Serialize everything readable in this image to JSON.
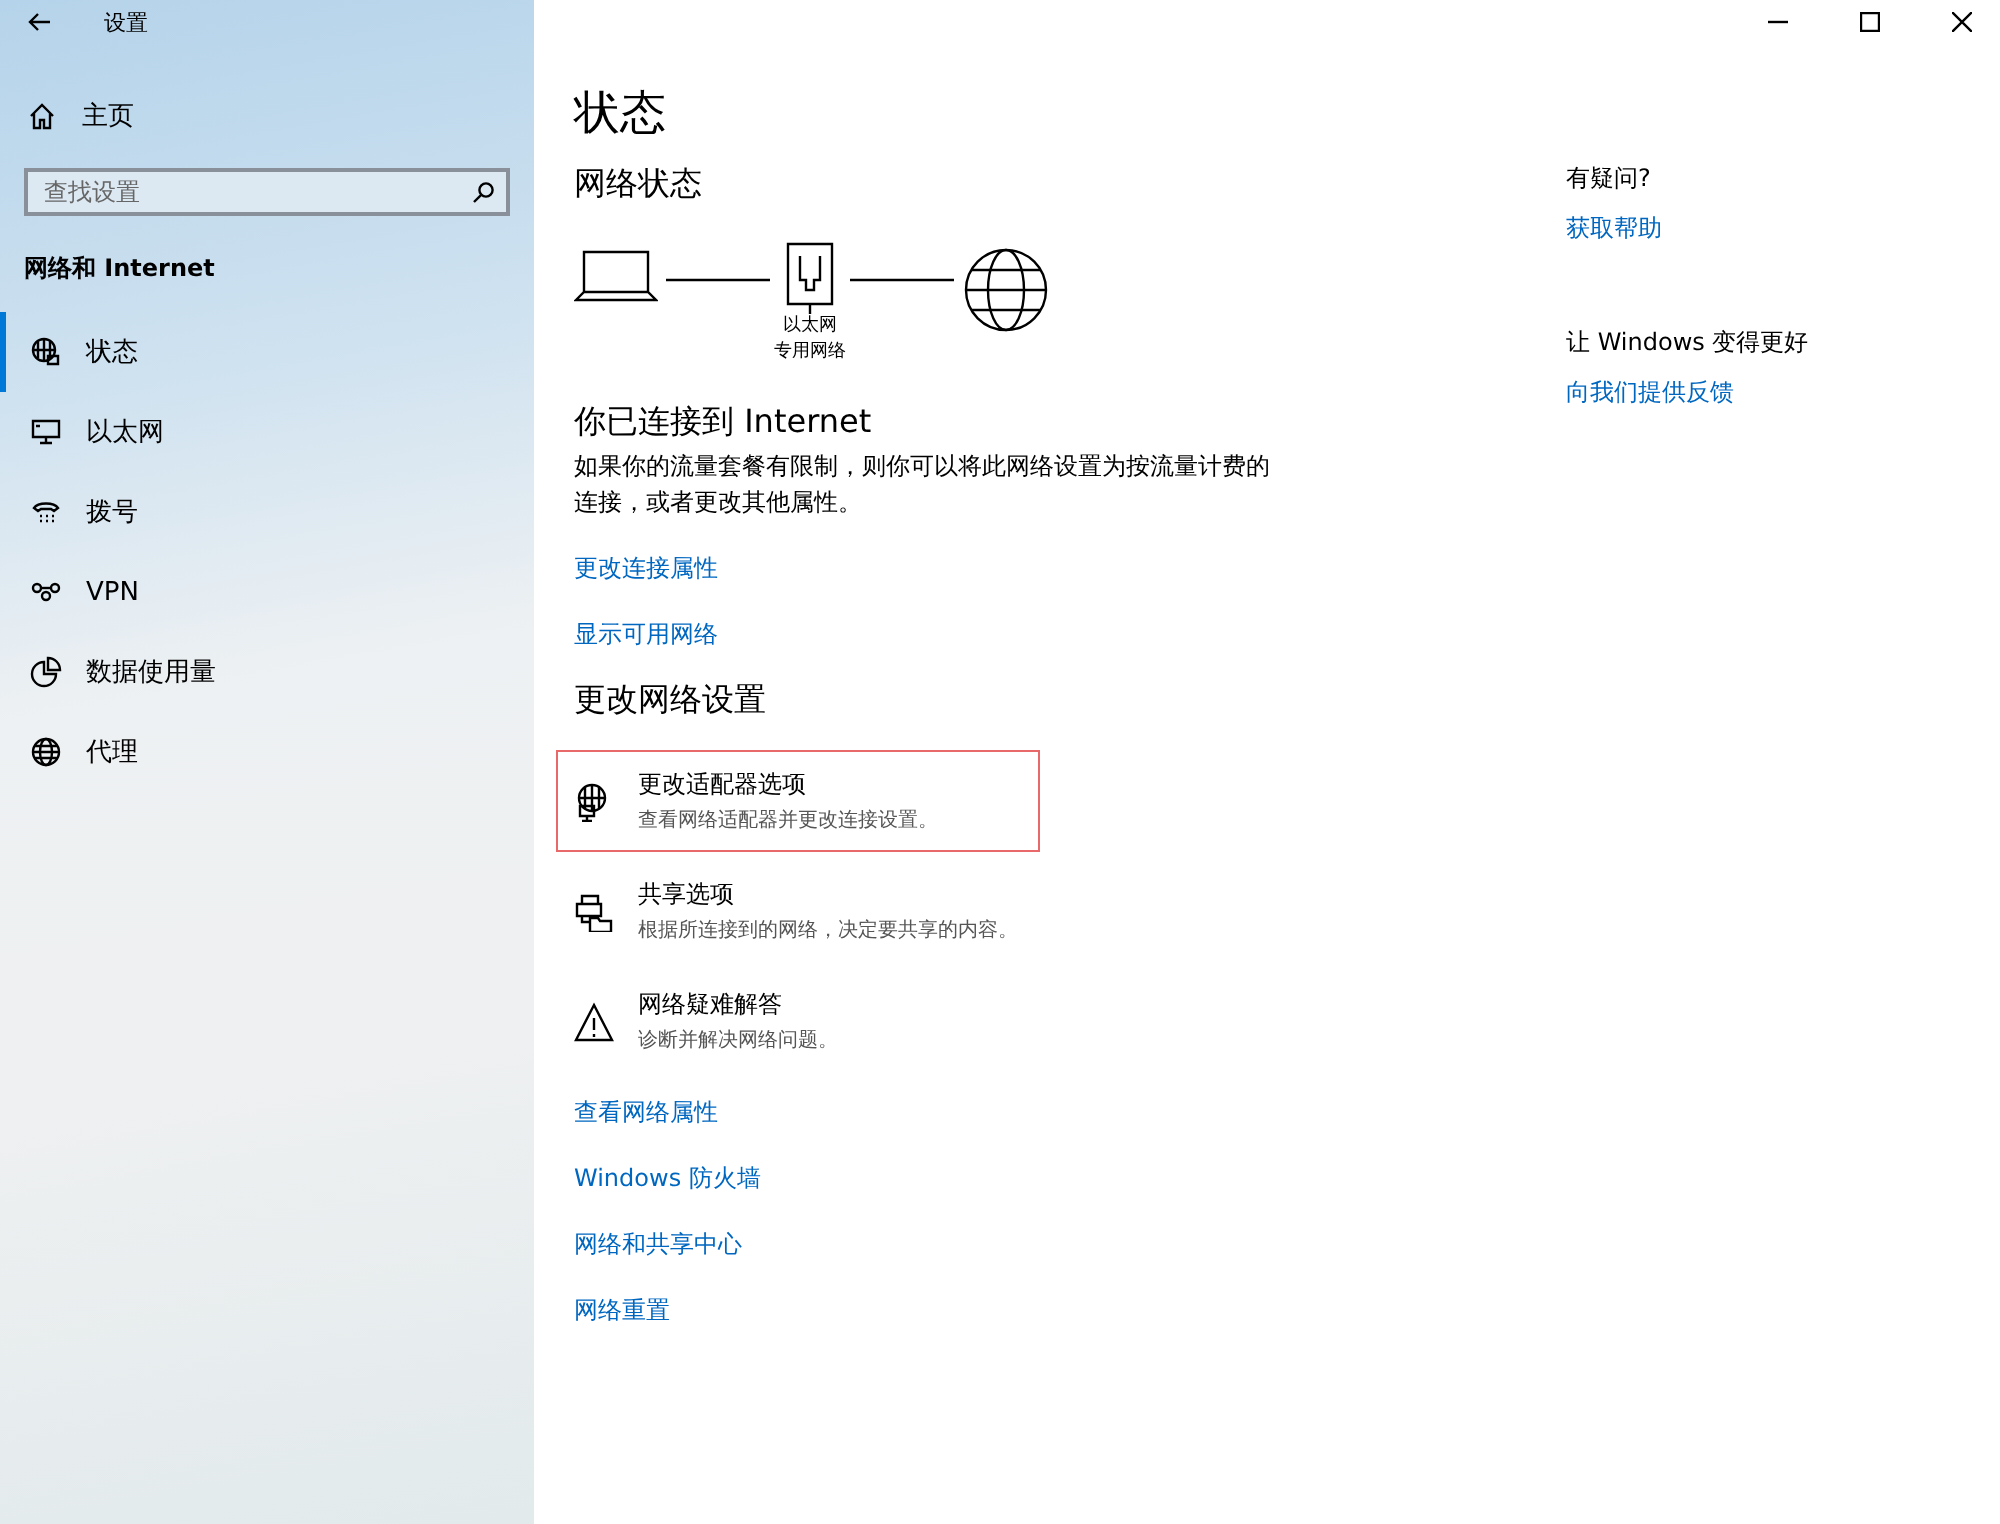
{
  "window": {
    "title": "设置"
  },
  "sidebar": {
    "home": "主页",
    "search": {
      "placeholder": "查找设置"
    },
    "section": "网络和 Internet",
    "items": [
      {
        "label": "状态",
        "selected": true
      },
      {
        "label": "以太网",
        "selected": false
      },
      {
        "label": "拨号",
        "selected": false
      },
      {
        "label": "VPN",
        "selected": false
      },
      {
        "label": "数据使用量",
        "selected": false
      },
      {
        "label": "代理",
        "selected": false
      }
    ]
  },
  "main": {
    "title": "状态",
    "network_heading": "网络状态",
    "diagram": {
      "adapter": "以太网",
      "profile": "专用网络"
    },
    "connected": "你已连接到 Internet",
    "description": "如果你的流量套餐有限制，则你可以将此网络设置为按流量计费的连接，或者更改其他属性。",
    "links_top": [
      "更改连接属性",
      "显示可用网络"
    ],
    "change_heading": "更改网络设置",
    "options": [
      {
        "title": "更改适配器选项",
        "subtitle": "查看网络适配器并更改连接设置。",
        "highlighted": true
      },
      {
        "title": "共享选项",
        "subtitle": "根据所连接到的网络，决定要共享的内容。",
        "highlighted": false
      },
      {
        "title": "网络疑难解答",
        "subtitle": "诊断并解决网络问题。",
        "highlighted": false
      }
    ],
    "links_bottom": [
      "查看网络属性",
      "Windows 防火墙",
      "网络和共享中心",
      "网络重置"
    ]
  },
  "aside": [
    {
      "heading": "有疑问?",
      "link": "获取帮助"
    },
    {
      "heading": "让 Windows 变得更好",
      "link": "向我们提供反馈"
    }
  ]
}
